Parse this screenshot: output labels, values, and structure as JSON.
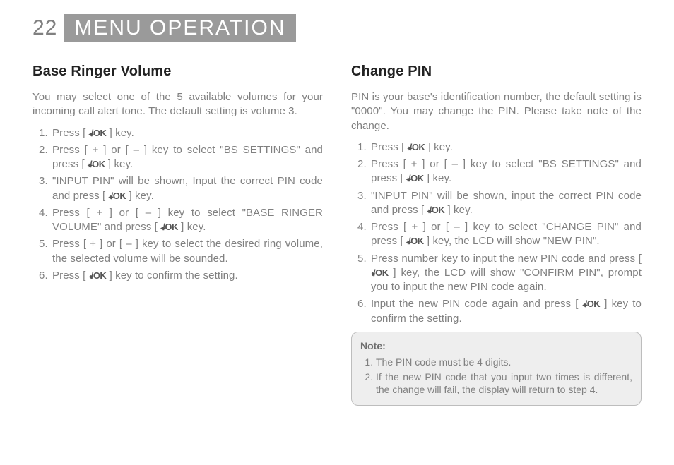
{
  "header": {
    "page_number": "22",
    "title": "MENU OPERATION"
  },
  "icon": {
    "ok_arrows": "◂▸",
    "ok_text": "/OK"
  },
  "left": {
    "heading": "Base Ringer Volume",
    "lead": "You may select one of the 5 available volumes for your incoming call alert tone. The default setting is volume 3.",
    "steps": [
      {
        "pre": "Press [ ",
        "icon": true,
        "post": " ] key."
      },
      {
        "pre": "Press [ + ] or [ – ] key to select \"BS SETTINGS\" and press [ ",
        "icon": true,
        "post": " ] key."
      },
      {
        "pre": "\"INPUT PIN\" will be shown, Input the correct PIN code and press [ ",
        "icon": true,
        "post": " ] key."
      },
      {
        "pre": "Press [ + ] or [ – ] key to select \"BASE RINGER VOLUME\" and press [ ",
        "icon": true,
        "post": " ] key."
      },
      {
        "pre": "Press [ + ] or [ – ] key to select the desired ring volume, the selected volume will be sounded.",
        "icon": false,
        "post": ""
      },
      {
        "pre": "Press [ ",
        "icon": true,
        "post": " ] key to confirm the setting."
      }
    ]
  },
  "right": {
    "heading": "Change PIN",
    "lead": "PIN is your base's identification number, the default setting is \"0000\". You may change the PIN. Please take note of the change.",
    "steps": [
      {
        "pre": "Press [ ",
        "icon": true,
        "post": " ] key."
      },
      {
        "pre": "Press [ + ] or [ – ] key to select \"BS SETTINGS\" and press [ ",
        "icon": true,
        "post": " ] key."
      },
      {
        "pre": "\"INPUT PIN\" will be shown, input the correct PIN code and press [ ",
        "icon": true,
        "post": " ] key."
      },
      {
        "pre": "Press [ + ] or [ – ] key to select \"CHANGE PIN\" and press [ ",
        "icon": true,
        "post": " ] key, the LCD will show \"NEW PIN\"."
      },
      {
        "pre": "Press number key to input the new PIN code and press [ ",
        "icon": true,
        "post": " ] key, the LCD will show \"CONFIRM PIN\", prompt you to input the new PIN code again."
      },
      {
        "pre": "Input the new PIN code again and press [ ",
        "icon": true,
        "post": " ] key to confirm the setting."
      }
    ],
    "note": {
      "title": "Note:",
      "items": [
        "The PIN code must be 4 digits.",
        "If the new PIN code that you input two times is different, the change will fail, the display will return to step 4."
      ]
    }
  }
}
